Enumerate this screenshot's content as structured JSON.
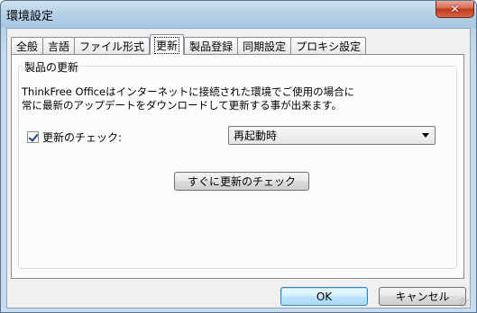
{
  "window": {
    "title": "環境設定",
    "close_glyph": "✕"
  },
  "tabs": [
    {
      "label": "全般",
      "active": false
    },
    {
      "label": "言語",
      "active": false
    },
    {
      "label": "ファイル形式",
      "active": false
    },
    {
      "label": "更新",
      "active": true
    },
    {
      "label": "製品登録",
      "active": false
    },
    {
      "label": "同期設定",
      "active": false
    },
    {
      "label": "プロキシ設定",
      "active": false
    }
  ],
  "update_group": {
    "title": "製品の更新",
    "description_line1": "ThinkFree Officeはインターネットに接続された環境でご使用の場合に",
    "description_line2": "常に最新のアップデートをダウンロードして更新する事が出来ます。",
    "check_label": "更新のチェック:",
    "check_checked": true,
    "frequency_selected": "再起動時",
    "check_now_label": "すぐに更新のチェック"
  },
  "footer": {
    "ok_label": "OK",
    "cancel_label": "キャンセル"
  }
}
